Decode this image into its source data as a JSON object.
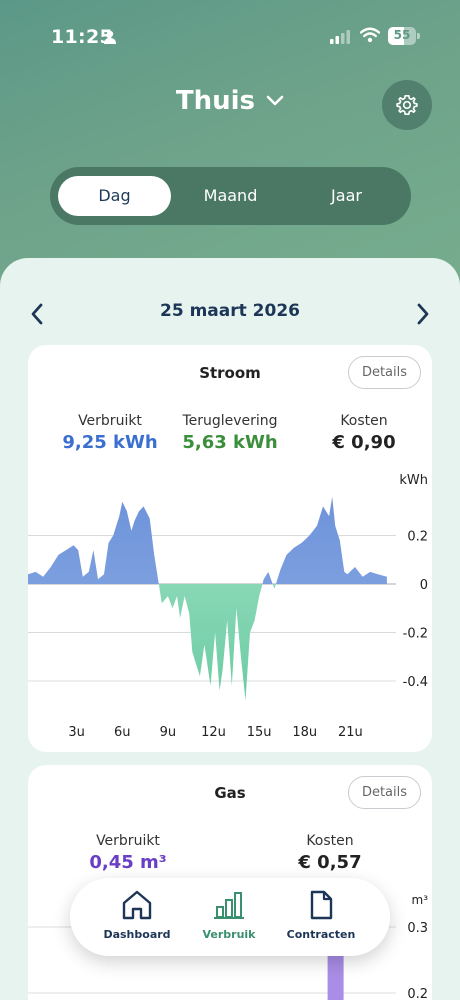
{
  "status_bar": {
    "time": "11:25",
    "battery": "55"
  },
  "header": {
    "title": "Thuis"
  },
  "period_tabs": [
    {
      "label": "Dag",
      "active": true
    },
    {
      "label": "Maand",
      "active": false
    },
    {
      "label": "Jaar",
      "active": false
    }
  ],
  "date": "25 maart 2026",
  "stroom": {
    "title": "Stroom",
    "details_label": "Details",
    "metrics": [
      {
        "label": "Verbruikt",
        "value": "9,25 kWh",
        "color": "#3a6fd0"
      },
      {
        "label": "Teruglevering",
        "value": "5,63 kWh",
        "color": "#3b8f3c"
      },
      {
        "label": "Kosten",
        "value": "€ 0,90",
        "color": "#222222"
      }
    ]
  },
  "gas": {
    "title": "Gas",
    "details_label": "Details",
    "metrics": [
      {
        "label": "Verbruikt",
        "value": "0,45 m³",
        "color": "#6a3fc4"
      },
      {
        "label": "Kosten",
        "value": "€ 0,57",
        "color": "#222222"
      }
    ]
  },
  "chart_data": [
    {
      "type": "area",
      "title": "Stroom",
      "ylabel": "kWh",
      "ylim": [
        -0.5,
        0.4
      ],
      "yticks": [
        "0.2",
        "0",
        "-0.2",
        "-0.4"
      ],
      "xticks": [
        "3u",
        "6u",
        "9u",
        "12u",
        "15u",
        "18u",
        "21u"
      ],
      "x_range_hours": [
        0,
        24
      ],
      "colors": {
        "consumption": "#7f9fe0",
        "return": "#8fd9b9"
      },
      "x": [
        0,
        0.5,
        1,
        1.5,
        2,
        2.5,
        3,
        3.3,
        3.6,
        4,
        4.3,
        4.6,
        5,
        5.3,
        5.6,
        6,
        6.2,
        6.5,
        6.8,
        7,
        7.3,
        7.6,
        8,
        8.3,
        8.6,
        8.8,
        9.2,
        9.5,
        9.8,
        10,
        10.3,
        10.6,
        10.8,
        11,
        11.3,
        11.6,
        12,
        12.3,
        12.6,
        12.8,
        13.1,
        13.4,
        13.7,
        14,
        14.3,
        14.6,
        14.9,
        15.2,
        15.5,
        15.8,
        16.2,
        16.6,
        17,
        17.5,
        18,
        18.5,
        19,
        19.4,
        19.8,
        20,
        20.2,
        20.5,
        20.8,
        21,
        21.5,
        22,
        22.5,
        23,
        23.6
      ],
      "values": [
        0.04,
        0.05,
        0.03,
        0.07,
        0.12,
        0.14,
        0.16,
        0.14,
        0.03,
        0.05,
        0.14,
        0.02,
        0.04,
        0.17,
        0.2,
        0.28,
        0.34,
        0.3,
        0.22,
        0.26,
        0.3,
        0.32,
        0.27,
        0.12,
        0.0,
        -0.08,
        -0.05,
        -0.1,
        -0.05,
        -0.14,
        -0.05,
        -0.12,
        -0.28,
        -0.32,
        -0.38,
        -0.25,
        -0.42,
        -0.2,
        -0.44,
        -0.35,
        -0.15,
        -0.42,
        -0.1,
        -0.3,
        -0.48,
        -0.2,
        -0.15,
        -0.05,
        0.02,
        0.05,
        -0.02,
        0.06,
        0.12,
        0.15,
        0.17,
        0.2,
        0.24,
        0.32,
        0.28,
        0.36,
        0.24,
        0.18,
        0.05,
        0.04,
        0.07,
        0.03,
        0.05,
        0.04,
        0.03
      ]
    },
    {
      "type": "bar",
      "title": "Gas",
      "ylabel": "m³",
      "yticks": [
        "0.3",
        "0.2"
      ],
      "colors": {
        "bar": "#a98de6"
      },
      "bars": [
        {
          "x": 19.7,
          "value": 0.31
        }
      ]
    }
  ],
  "bottom_nav": [
    {
      "label": "Dashboard",
      "icon": "house-icon",
      "color": "#1d3557"
    },
    {
      "label": "Verbruik",
      "icon": "bar-chart-icon",
      "color": "#3a8f6e"
    },
    {
      "label": "Contracten",
      "icon": "document-icon",
      "color": "#1d3557"
    }
  ]
}
